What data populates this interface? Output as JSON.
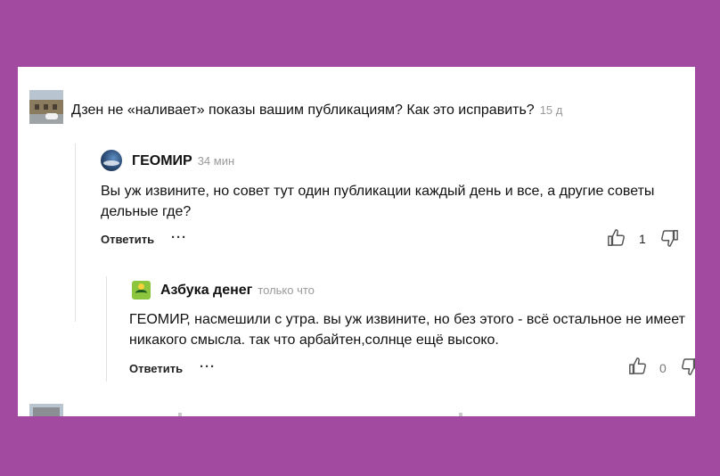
{
  "post": {
    "title": "Дзен не «наливает» показы вашим публикациям? Как это исправить?",
    "time": "15 д"
  },
  "comment1": {
    "author": "ГЕОМИР",
    "time": "34 мин",
    "text_line1": "Вы уж извините, но совет тут один публикации каждый день и все, а другие советы",
    "text_line2": "дельные где?",
    "reply_label": "Ответить",
    "more_label": "···",
    "likes": "1"
  },
  "comment2": {
    "author": "Азбука денег",
    "time": "только что",
    "text_line1": "ГЕОМИР, насмешили с утра. вы уж извините, но без этого - всё остальное не имеет",
    "text_line2": "никакого смысла. так что арбайтен,солнце ещё высоко.",
    "reply_label": "Ответить",
    "more_label": "···",
    "likes": "0"
  },
  "colors": {
    "background": "#a14aa0",
    "card": "#ffffff",
    "meta_text": "#9a9a9a"
  },
  "icons": [
    "thumbs-up-icon",
    "thumbs-down-icon",
    "more-dots-icon"
  ]
}
